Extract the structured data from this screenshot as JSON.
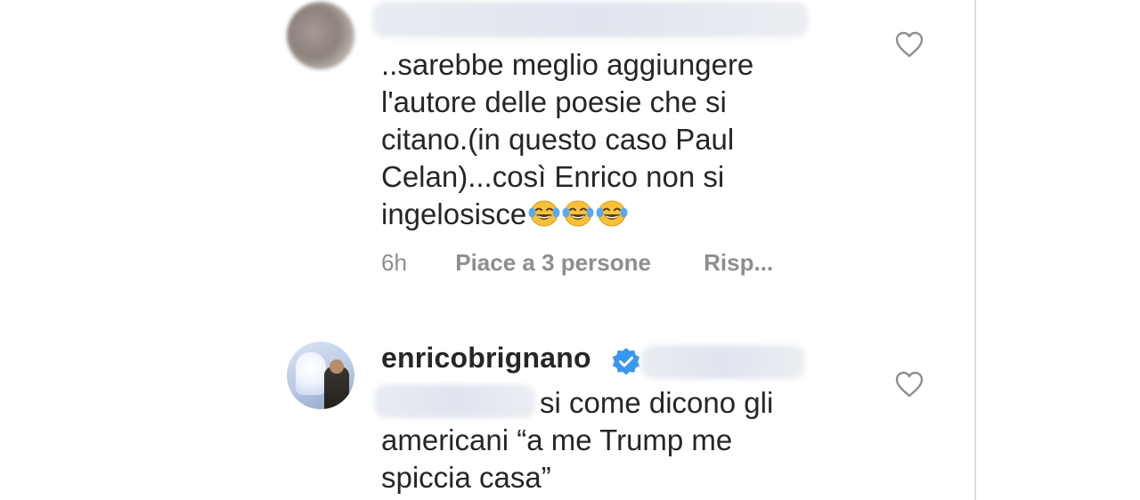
{
  "comments": [
    {
      "text": "..sarebbe meglio aggiungere\nl'autore delle poesie che si\ncitano.(in questo caso Paul\nCelan)...così Enrico non si\ningelosisce",
      "emoji_count": 3,
      "emoji_icon": "face-with-tears-of-joy",
      "time": "6h",
      "likes": "Piace a 3 persone",
      "reply": "Risp..."
    },
    {
      "username": "enricobrignano",
      "verified": true,
      "text_first_line": "si come dicono gli",
      "text_rest": "americani “a me Trump me\nspiccia casa”"
    }
  ],
  "colors": {
    "text": "#262626",
    "meta": "#8e8e8e",
    "verified_blue": "#3897f0",
    "heart_outline": "#8e8e8e"
  },
  "icons": [
    "heart-outline-icon",
    "verified-badge-icon",
    "face-with-tears-of-joy-emoji"
  ]
}
